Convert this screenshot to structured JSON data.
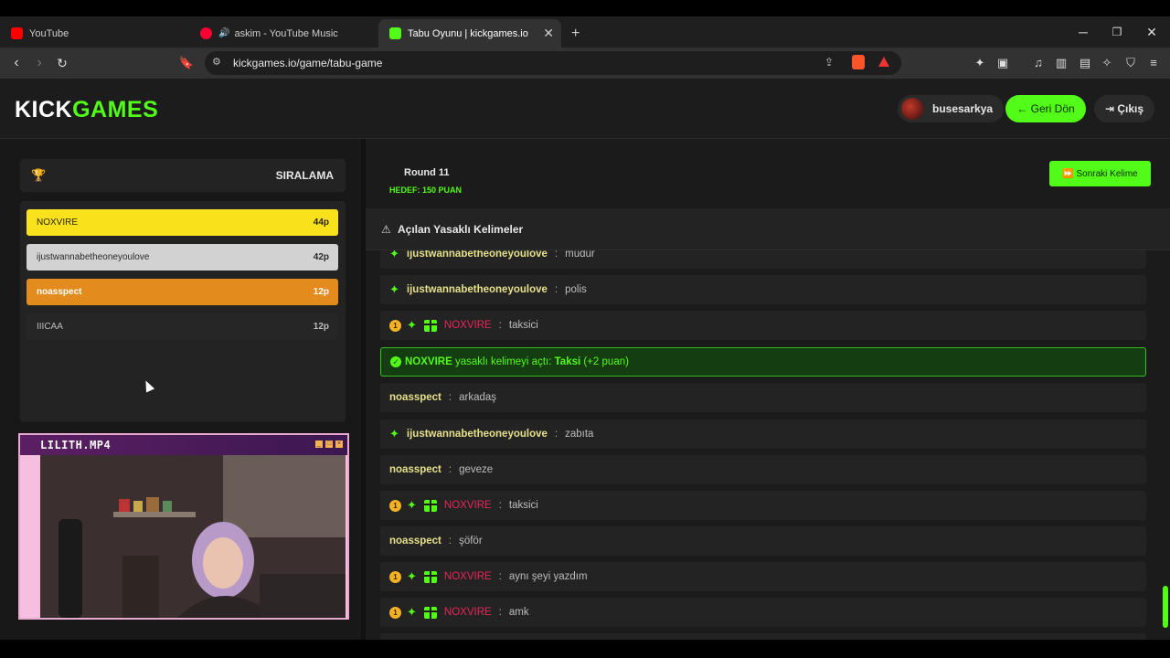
{
  "browser": {
    "tabs": [
      {
        "title": "YouTube",
        "favicon_color": "#ff0000"
      },
      {
        "title": "askim - YouTube Music",
        "favicon_color": "#ff0033"
      },
      {
        "title": "Tabu Oyunu | kickgames.io",
        "favicon_color": "#53fc18"
      }
    ],
    "url": "kickgames.io/game/tabu-game"
  },
  "header": {
    "logo_part1": "KICK",
    "logo_part2": "GAMES",
    "username": "busesarkya",
    "back_label": "← Geri Dön",
    "exit_label": "⇥ Çıkış"
  },
  "ranking": {
    "title": "SIRALAMA",
    "rows": [
      {
        "name": "NOXVIRE",
        "points": "44p",
        "bg": "#f9e21c",
        "color": "#2b2400"
      },
      {
        "name": "ijustwannabetheoneyoulove",
        "points": "42p",
        "bg": "#d2d2d2",
        "color": "#2a2a2a"
      },
      {
        "name": "noasspect",
        "points": "12p",
        "bg": "#e38b1c",
        "color": "#ffffff"
      },
      {
        "name": "IIICAA",
        "points": "12p",
        "bg": "#262626",
        "color": "#bdbdbd"
      }
    ]
  },
  "video": {
    "title": "LILITH.MP4"
  },
  "game": {
    "round": "Round 11",
    "target": "HEDEF: 150 PUAN",
    "next_label": "⏩ Sonraki Kelime",
    "section_label": "Açılan Yasaklı Kelimeler"
  },
  "chat": [
    {
      "type": "msg",
      "user": "ijustwannabetheoneyoulove",
      "style": "spark",
      "text": "müdür"
    },
    {
      "type": "msg",
      "user": "ijustwannabetheoneyoulove",
      "style": "spark",
      "text": "polis"
    },
    {
      "type": "msg",
      "user": "NOXVIRE",
      "style": "badges",
      "text": "taksici"
    },
    {
      "type": "sys",
      "user": "NOXVIRE",
      "mid": "yasaklı kelimeyi açtı:",
      "word": "Taksi",
      "bonus": "(+2 puan)"
    },
    {
      "type": "msg",
      "user": "noasspect",
      "style": "plain",
      "text": "arkadaş"
    },
    {
      "type": "msg",
      "user": "ijustwannabetheoneyoulove",
      "style": "spark",
      "text": "zabıta"
    },
    {
      "type": "msg",
      "user": "noasspect",
      "style": "plain",
      "text": "geveze"
    },
    {
      "type": "msg",
      "user": "NOXVIRE",
      "style": "badges",
      "text": "taksici"
    },
    {
      "type": "msg",
      "user": "noasspect",
      "style": "plain",
      "text": "şöför"
    },
    {
      "type": "msg",
      "user": "NOXVIRE",
      "style": "badges",
      "text": "aynı şeyi yazdım"
    },
    {
      "type": "msg",
      "user": "NOXVIRE",
      "style": "badges",
      "text": "amk"
    }
  ],
  "badge_number": "1",
  "colors": {
    "accent": "#53fc18",
    "noxvire": "#e8265a",
    "user_yellow": "#e6e08a"
  }
}
